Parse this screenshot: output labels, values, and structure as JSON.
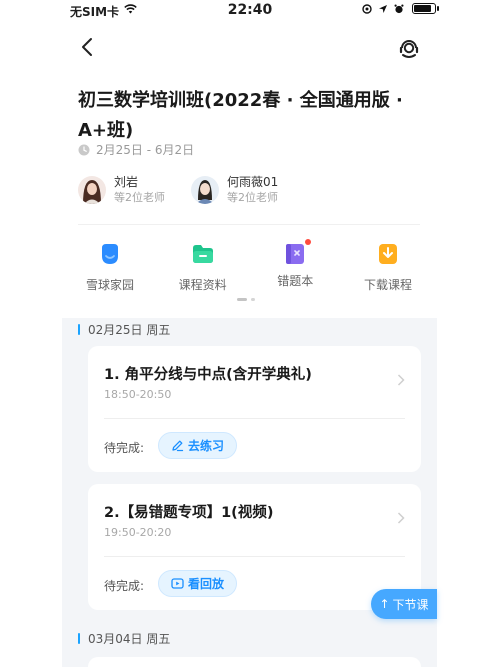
{
  "status_bar": {
    "carrier": "无SIM卡",
    "time": "22:40",
    "battery_level": 0.85
  },
  "nav": {
    "back_icon": "chevron-left-icon",
    "service_icon": "customer-service-icon"
  },
  "course": {
    "title": "初三数学培训班(2022春 · 全国通用版 · A+班)",
    "date_range": "2月25日 - 6月2日"
  },
  "teachers": [
    {
      "name": "刘岩",
      "subtitle": "等2位老师"
    },
    {
      "name": "何雨薇01",
      "subtitle": "等2位老师"
    }
  ],
  "entries": [
    {
      "label": "雪球家园",
      "icon": "home-icon",
      "color": "#2b8cff"
    },
    {
      "label": "课程资料",
      "icon": "folder-icon",
      "color": "#1ec48c"
    },
    {
      "label": "错题本",
      "icon": "notebook-icon",
      "color": "#8a6cf0"
    },
    {
      "label": "下载课程",
      "icon": "download-icon",
      "color": "#ffae1f"
    }
  ],
  "schedule": {
    "days": [
      {
        "date": "02月25日 周五",
        "lessons": [
          {
            "title": "1. 角平分线与中点(含开学典礼)",
            "time": "18:50-20:50",
            "status": "待完成:",
            "action": "去练习",
            "action_icon": "pencil-icon"
          },
          {
            "title": "2.【易错题专项】1(视频)",
            "time": "19:50-20:20",
            "status": "待完成:",
            "action": "看回放",
            "action_icon": "replay-icon"
          }
        ]
      },
      {
        "date": "03月04日 周五",
        "lessons": []
      }
    ],
    "next_button": "下节课"
  },
  "accent_color": "#1a8fff"
}
